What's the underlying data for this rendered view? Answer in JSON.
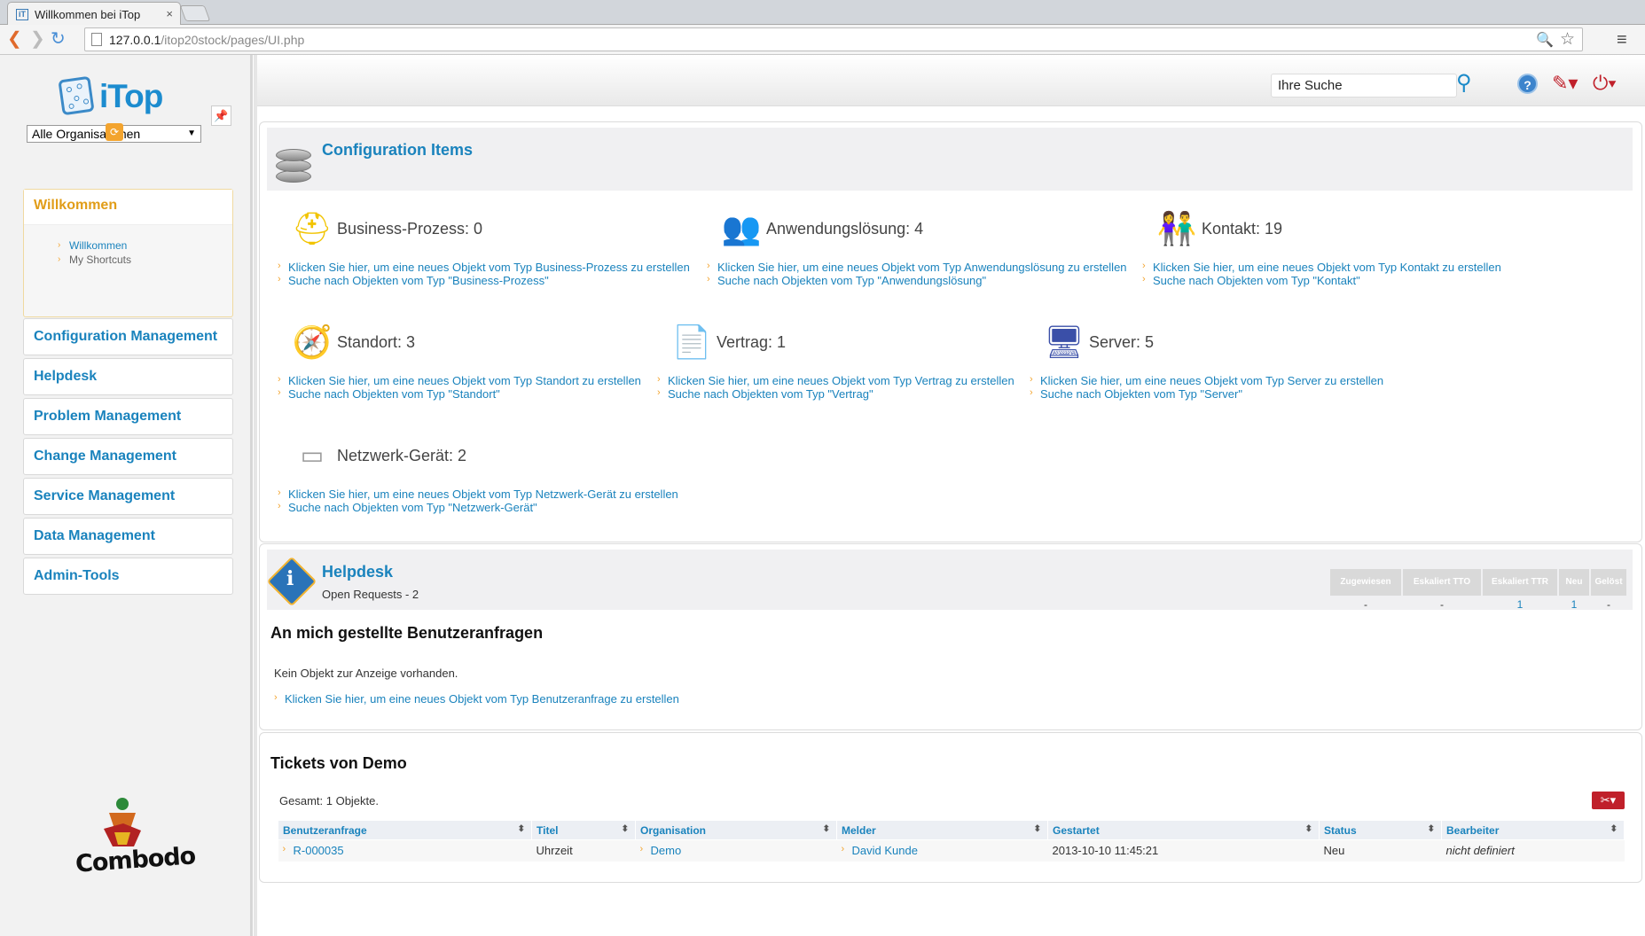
{
  "browser": {
    "tab_title": "Willkommen bei iTop",
    "tab_close": "×",
    "favicon": "iT",
    "url_host": "127.0.0.1",
    "url_path": "/itop20stock/pages/UI.php"
  },
  "sidebar": {
    "logo_text": "iTop",
    "org_select": "Alle Organisationen",
    "accordion": [
      {
        "label": "Willkommen",
        "items": [
          "Willkommen",
          "My Shortcuts"
        ]
      },
      {
        "label": "Configuration Management"
      },
      {
        "label": "Helpdesk"
      },
      {
        "label": "Problem Management"
      },
      {
        "label": "Change Management"
      },
      {
        "label": "Service Management"
      },
      {
        "label": "Data Management"
      },
      {
        "label": "Admin-Tools"
      }
    ],
    "footer_logo": "Combodo"
  },
  "header": {
    "search_value": "Ihre Suche"
  },
  "ci_panel": {
    "title": "Configuration Items",
    "items": [
      {
        "label": "Business-Prozess: 0",
        "icon": "helmet-icon",
        "create": "Klicken Sie hier, um eine neues Objekt vom Typ Business-Prozess zu erstellen",
        "search": "Suche nach Objekten vom Typ \"Business-Prozess\""
      },
      {
        "label": "Anwendungslösung: 4",
        "icon": "application-icon",
        "create": "Klicken Sie hier, um eine neues Objekt vom Typ Anwendungslösung zu erstellen",
        "search": "Suche nach Objekten vom Typ \"Anwendungslösung\""
      },
      {
        "label": "Kontakt: 19",
        "icon": "contact-icon",
        "create": "Klicken Sie hier, um eine neues Objekt vom Typ Kontakt zu erstellen",
        "search": "Suche nach Objekten vom Typ \"Kontakt\""
      },
      {
        "label": "Standort: 3",
        "icon": "location-icon",
        "create": "Klicken Sie hier, um eine neues Objekt vom Typ Standort zu erstellen",
        "search": "Suche nach Objekten vom Typ \"Standort\""
      },
      {
        "label": "Vertrag: 1",
        "icon": "contract-icon",
        "create": "Klicken Sie hier, um eine neues Objekt vom Typ Vertrag zu erstellen",
        "search": "Suche nach Objekten vom Typ \"Vertrag\""
      },
      {
        "label": "Server: 5",
        "icon": "server-icon",
        "create": "Klicken Sie hier, um eine neues Objekt vom Typ Server zu erstellen",
        "search": "Suche nach Objekten vom Typ \"Server\""
      },
      {
        "label": "Netzwerk-Gerät: 2",
        "icon": "network-device-icon",
        "create": "Klicken Sie hier, um eine neues Objekt vom Typ Netzwerk-Gerät zu erstellen",
        "search": "Suche nach Objekten vom Typ \"Netzwerk-Gerät\""
      }
    ]
  },
  "helpdesk_panel": {
    "title": "Helpdesk",
    "subtitle": "Open Requests - 2",
    "states": [
      {
        "label": "Zugewiesen",
        "value": "-"
      },
      {
        "label": "Eskaliert TTO",
        "value": "-"
      },
      {
        "label": "Eskaliert TTR",
        "value": "1"
      },
      {
        "label": "Neu",
        "value": "1"
      },
      {
        "label": "Gelöst",
        "value": "-"
      }
    ],
    "section_title": "An mich gestellte Benutzeranfragen",
    "empty_text": "Kein Objekt zur Anzeige vorhanden.",
    "create_link": "Klicken Sie hier, um eine neues Objekt vom Typ Benutzeranfrage zu erstellen"
  },
  "tickets_panel": {
    "title": "Tickets von Demo",
    "count_text": "Gesamt: 1 Objekte.",
    "columns": [
      "Benutzeranfrage",
      "Titel",
      "Organisation",
      "Melder",
      "Gestartet",
      "Status",
      "Bearbeiter"
    ],
    "rows": [
      [
        "R-000035",
        "Uhrzeit",
        "Demo",
        "David Kunde",
        "2013-10-10 11:45:21",
        "Neu",
        "nicht definiert"
      ]
    ]
  },
  "colors": {
    "link": "#1a83bd",
    "accent_orange": "#e19d18",
    "danger": "#c0202a"
  }
}
